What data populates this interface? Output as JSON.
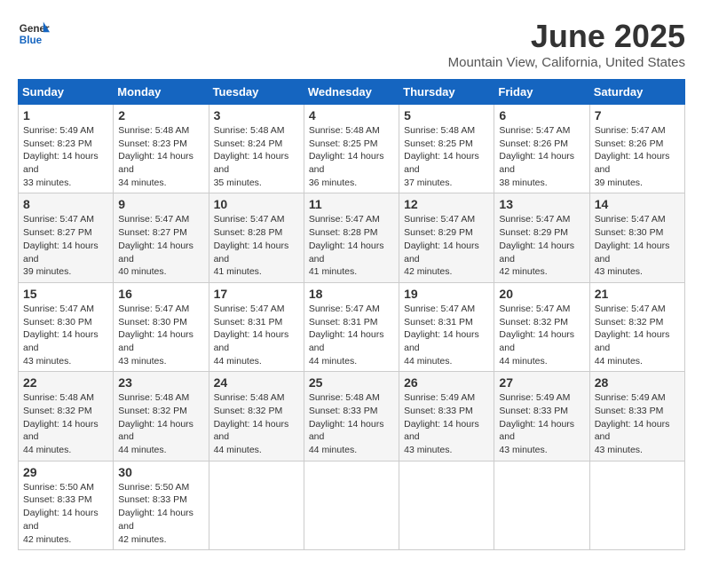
{
  "header": {
    "logo_general": "General",
    "logo_blue": "Blue",
    "title": "June 2025",
    "subtitle": "Mountain View, California, United States"
  },
  "calendar": {
    "days_of_week": [
      "Sunday",
      "Monday",
      "Tuesday",
      "Wednesday",
      "Thursday",
      "Friday",
      "Saturday"
    ],
    "weeks": [
      [
        {
          "day": "1",
          "sunrise": "Sunrise: 5:49 AM",
          "sunset": "Sunset: 8:23 PM",
          "daylight": "Daylight: 14 hours and 33 minutes."
        },
        {
          "day": "2",
          "sunrise": "Sunrise: 5:48 AM",
          "sunset": "Sunset: 8:23 PM",
          "daylight": "Daylight: 14 hours and 34 minutes."
        },
        {
          "day": "3",
          "sunrise": "Sunrise: 5:48 AM",
          "sunset": "Sunset: 8:24 PM",
          "daylight": "Daylight: 14 hours and 35 minutes."
        },
        {
          "day": "4",
          "sunrise": "Sunrise: 5:48 AM",
          "sunset": "Sunset: 8:25 PM",
          "daylight": "Daylight: 14 hours and 36 minutes."
        },
        {
          "day": "5",
          "sunrise": "Sunrise: 5:48 AM",
          "sunset": "Sunset: 8:25 PM",
          "daylight": "Daylight: 14 hours and 37 minutes."
        },
        {
          "day": "6",
          "sunrise": "Sunrise: 5:47 AM",
          "sunset": "Sunset: 8:26 PM",
          "daylight": "Daylight: 14 hours and 38 minutes."
        },
        {
          "day": "7",
          "sunrise": "Sunrise: 5:47 AM",
          "sunset": "Sunset: 8:26 PM",
          "daylight": "Daylight: 14 hours and 39 minutes."
        }
      ],
      [
        {
          "day": "8",
          "sunrise": "Sunrise: 5:47 AM",
          "sunset": "Sunset: 8:27 PM",
          "daylight": "Daylight: 14 hours and 39 minutes."
        },
        {
          "day": "9",
          "sunrise": "Sunrise: 5:47 AM",
          "sunset": "Sunset: 8:27 PM",
          "daylight": "Daylight: 14 hours and 40 minutes."
        },
        {
          "day": "10",
          "sunrise": "Sunrise: 5:47 AM",
          "sunset": "Sunset: 8:28 PM",
          "daylight": "Daylight: 14 hours and 41 minutes."
        },
        {
          "day": "11",
          "sunrise": "Sunrise: 5:47 AM",
          "sunset": "Sunset: 8:28 PM",
          "daylight": "Daylight: 14 hours and 41 minutes."
        },
        {
          "day": "12",
          "sunrise": "Sunrise: 5:47 AM",
          "sunset": "Sunset: 8:29 PM",
          "daylight": "Daylight: 14 hours and 42 minutes."
        },
        {
          "day": "13",
          "sunrise": "Sunrise: 5:47 AM",
          "sunset": "Sunset: 8:29 PM",
          "daylight": "Daylight: 14 hours and 42 minutes."
        },
        {
          "day": "14",
          "sunrise": "Sunrise: 5:47 AM",
          "sunset": "Sunset: 8:30 PM",
          "daylight": "Daylight: 14 hours and 43 minutes."
        }
      ],
      [
        {
          "day": "15",
          "sunrise": "Sunrise: 5:47 AM",
          "sunset": "Sunset: 8:30 PM",
          "daylight": "Daylight: 14 hours and 43 minutes."
        },
        {
          "day": "16",
          "sunrise": "Sunrise: 5:47 AM",
          "sunset": "Sunset: 8:30 PM",
          "daylight": "Daylight: 14 hours and 43 minutes."
        },
        {
          "day": "17",
          "sunrise": "Sunrise: 5:47 AM",
          "sunset": "Sunset: 8:31 PM",
          "daylight": "Daylight: 14 hours and 44 minutes."
        },
        {
          "day": "18",
          "sunrise": "Sunrise: 5:47 AM",
          "sunset": "Sunset: 8:31 PM",
          "daylight": "Daylight: 14 hours and 44 minutes."
        },
        {
          "day": "19",
          "sunrise": "Sunrise: 5:47 AM",
          "sunset": "Sunset: 8:31 PM",
          "daylight": "Daylight: 14 hours and 44 minutes."
        },
        {
          "day": "20",
          "sunrise": "Sunrise: 5:47 AM",
          "sunset": "Sunset: 8:32 PM",
          "daylight": "Daylight: 14 hours and 44 minutes."
        },
        {
          "day": "21",
          "sunrise": "Sunrise: 5:47 AM",
          "sunset": "Sunset: 8:32 PM",
          "daylight": "Daylight: 14 hours and 44 minutes."
        }
      ],
      [
        {
          "day": "22",
          "sunrise": "Sunrise: 5:48 AM",
          "sunset": "Sunset: 8:32 PM",
          "daylight": "Daylight: 14 hours and 44 minutes."
        },
        {
          "day": "23",
          "sunrise": "Sunrise: 5:48 AM",
          "sunset": "Sunset: 8:32 PM",
          "daylight": "Daylight: 14 hours and 44 minutes."
        },
        {
          "day": "24",
          "sunrise": "Sunrise: 5:48 AM",
          "sunset": "Sunset: 8:32 PM",
          "daylight": "Daylight: 14 hours and 44 minutes."
        },
        {
          "day": "25",
          "sunrise": "Sunrise: 5:48 AM",
          "sunset": "Sunset: 8:33 PM",
          "daylight": "Daylight: 14 hours and 44 minutes."
        },
        {
          "day": "26",
          "sunrise": "Sunrise: 5:49 AM",
          "sunset": "Sunset: 8:33 PM",
          "daylight": "Daylight: 14 hours and 43 minutes."
        },
        {
          "day": "27",
          "sunrise": "Sunrise: 5:49 AM",
          "sunset": "Sunset: 8:33 PM",
          "daylight": "Daylight: 14 hours and 43 minutes."
        },
        {
          "day": "28",
          "sunrise": "Sunrise: 5:49 AM",
          "sunset": "Sunset: 8:33 PM",
          "daylight": "Daylight: 14 hours and 43 minutes."
        }
      ],
      [
        {
          "day": "29",
          "sunrise": "Sunrise: 5:50 AM",
          "sunset": "Sunset: 8:33 PM",
          "daylight": "Daylight: 14 hours and 42 minutes."
        },
        {
          "day": "30",
          "sunrise": "Sunrise: 5:50 AM",
          "sunset": "Sunset: 8:33 PM",
          "daylight": "Daylight: 14 hours and 42 minutes."
        },
        null,
        null,
        null,
        null,
        null
      ]
    ]
  }
}
